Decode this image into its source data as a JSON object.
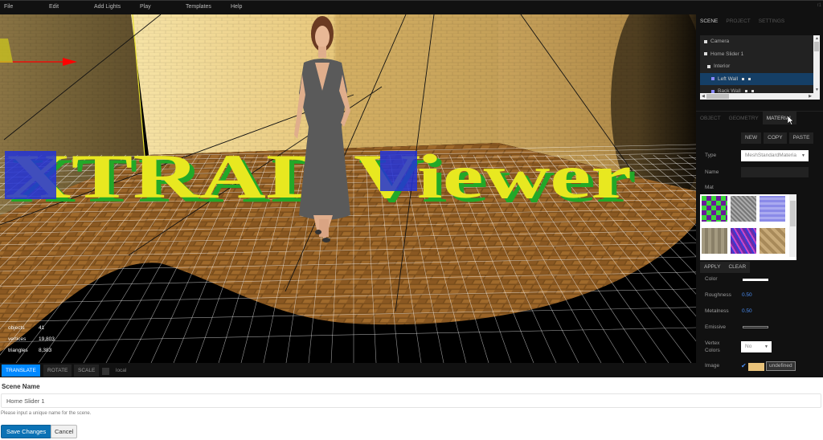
{
  "menubar": {
    "items": [
      "File",
      "Edit",
      "Add Lights",
      "Play",
      "Templates",
      "Help"
    ],
    "version": "r1"
  },
  "viewport": {
    "scene_text": "XTRAD Viewer",
    "stats": [
      {
        "label": "objects",
        "value": "41"
      },
      {
        "label": "vertices",
        "value": "19,803"
      },
      {
        "label": "triangles",
        "value": "8,383"
      }
    ]
  },
  "toolbar": {
    "translate": "TRANSLATE",
    "rotate": "ROTATE",
    "scale": "SCALE",
    "local": "local",
    "active": "translate"
  },
  "sidebar": {
    "top_tabs": [
      "SCENE",
      "PROJECT",
      "SETTINGS"
    ],
    "top_active": "SCENE",
    "outliner": [
      {
        "label": "Camera",
        "depth": 0
      },
      {
        "label": "Home Slider 1",
        "depth": 0
      },
      {
        "label": "Interior",
        "depth": 1
      },
      {
        "label": "Left Wall",
        "depth": 2,
        "selected": true
      },
      {
        "label": "Back Wall",
        "depth": 2
      }
    ],
    "sub_tabs": [
      "OBJECT",
      "GEOMETRY",
      "MATERIAL"
    ],
    "sub_active": "MATERIAL",
    "material": {
      "new": "NEW",
      "copy": "COPY",
      "paste": "PASTE",
      "type_label": "Type",
      "type_value": "MeshStandardMateria",
      "name_label": "Name",
      "name_value": "",
      "mat_label": "Mat",
      "apply": "APPLY",
      "clear": "CLEAR",
      "color_label": "Color",
      "color_value": "#ffffff",
      "roughness_label": "Roughness",
      "roughness_value": "0.50",
      "metalness_label": "Metalness",
      "metalness_value": "0.50",
      "emissive_label": "Emissive",
      "emissive_value": "#000000",
      "vertex_colors_label": "Vertex Colors",
      "vertex_colors_value": "No",
      "image_label": "Image",
      "image_checked": true,
      "image_button": "undefined"
    }
  },
  "form": {
    "heading": "Scene Name",
    "scene_name": "Home Slider 1",
    "help": "Please input a unique name for the scene.",
    "save": "Save Changes",
    "cancel": "Cancel"
  },
  "colors": {
    "accent": "#0088ff",
    "save_button": "#0b72b5",
    "selection": "#153f66",
    "value_blue": "#4a8cf0"
  }
}
